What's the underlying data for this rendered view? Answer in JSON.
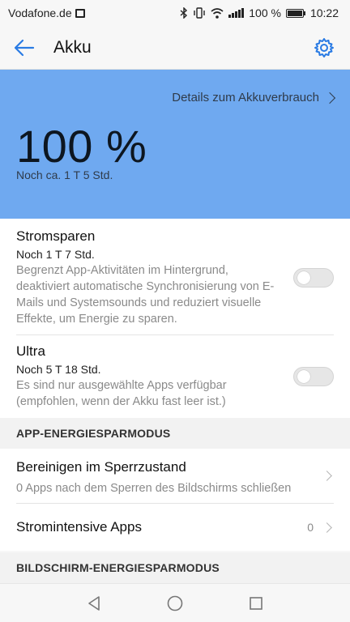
{
  "statusbar": {
    "carrier": "Vodafone.de",
    "battery": "100 %",
    "time": "10:22"
  },
  "appbar": {
    "title": "Akku"
  },
  "hero": {
    "details_link": "Details zum Akkuverbrauch",
    "percent": "100 %",
    "remaining": "Noch ca. 1 T 5 Std."
  },
  "power_saving": [
    {
      "title": "Stromsparen",
      "time": "Noch 1 T 7 Std.",
      "desc": "Begrenzt App-Aktivitäten im Hintergrund, deaktiviert automatische Synchronisierung von E-Mails und Systemsounds und reduziert visuelle Effekte, um Energie zu sparen.",
      "enabled": false
    },
    {
      "title": "Ultra",
      "time": "Noch 5 T 18 Std.",
      "desc": "Es sind nur ausgewählte Apps verfügbar (empfohlen, wenn der Akku fast leer ist.)",
      "enabled": false
    }
  ],
  "app_section": {
    "header": "APP-ENERGIESPARMODUS",
    "items": [
      {
        "title": "Bereinigen im Sperrzustand",
        "subtitle": "0 Apps nach dem Sperren des Bildschirms schließen"
      },
      {
        "title": "Stromintensive Apps",
        "value": "0"
      }
    ]
  },
  "screen_section": {
    "header": "BILDSCHIRM-ENERGIESPARMODUS"
  },
  "colors": {
    "accent": "#2a7be4",
    "hero_bg": "#6fa9f0"
  }
}
